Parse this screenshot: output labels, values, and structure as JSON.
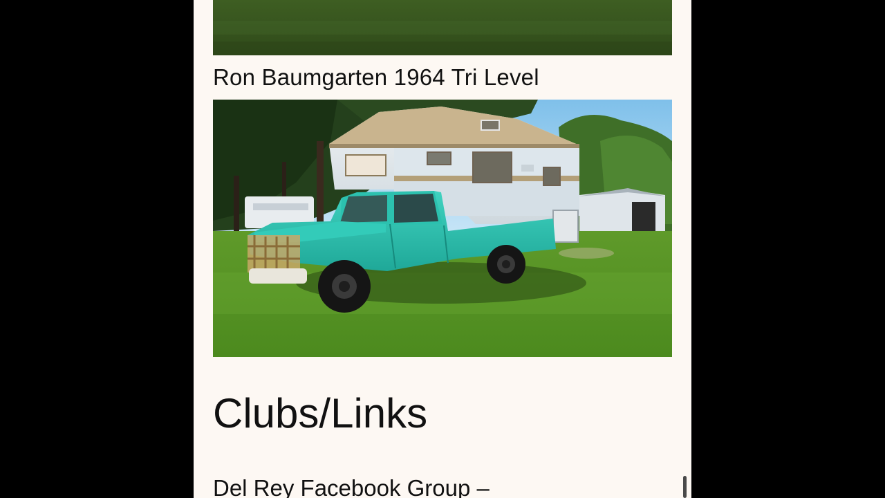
{
  "gallery": {
    "caption": "Ron Baumgarten 1964 Tri Level"
  },
  "section": {
    "heading": "Clubs/Links"
  },
  "links": {
    "first": "Del Rey Facebook Group –"
  },
  "colors": {
    "page_background": "#fdf8f3",
    "letterbox": "#000000",
    "text": "#111111"
  }
}
